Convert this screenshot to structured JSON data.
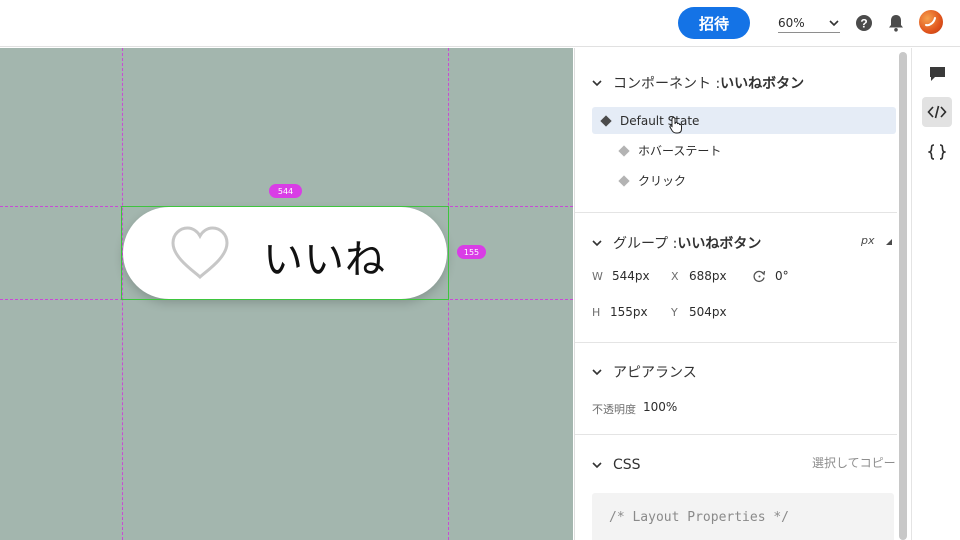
{
  "toolbar": {
    "invite_label": "招待",
    "zoom_value": "60%"
  },
  "canvas": {
    "button_text": "いいね",
    "width_badge": "544",
    "height_badge": "155"
  },
  "component": {
    "header_prefix": "コンポーネント : ",
    "header_name": "いいねボタン",
    "states": [
      {
        "label": "Default State",
        "selected": true
      },
      {
        "label": "ホバーステート",
        "selected": false
      },
      {
        "label": "クリック",
        "selected": false
      }
    ]
  },
  "group": {
    "header_prefix": "グループ : ",
    "header_name": "いいねボタン",
    "unit": "px",
    "w_label": "W",
    "w_value": "544px",
    "x_label": "X",
    "x_value": "688px",
    "rotation_value": "0°",
    "h_label": "H",
    "h_value": "155px",
    "y_label": "Y",
    "y_value": "504px"
  },
  "appearance": {
    "header": "アピアランス",
    "opacity_label": "不透明度",
    "opacity_value": "100%"
  },
  "css": {
    "header": "CSS",
    "copy_hint": "選択してコピー",
    "code_line": "/* Layout Properties */"
  },
  "colors": {
    "accent": "#1473e6",
    "canvas_bg": "#a3b6ae",
    "guide": "#c94ad6",
    "selection": "#3ec53e",
    "badge": "#d93de6"
  }
}
